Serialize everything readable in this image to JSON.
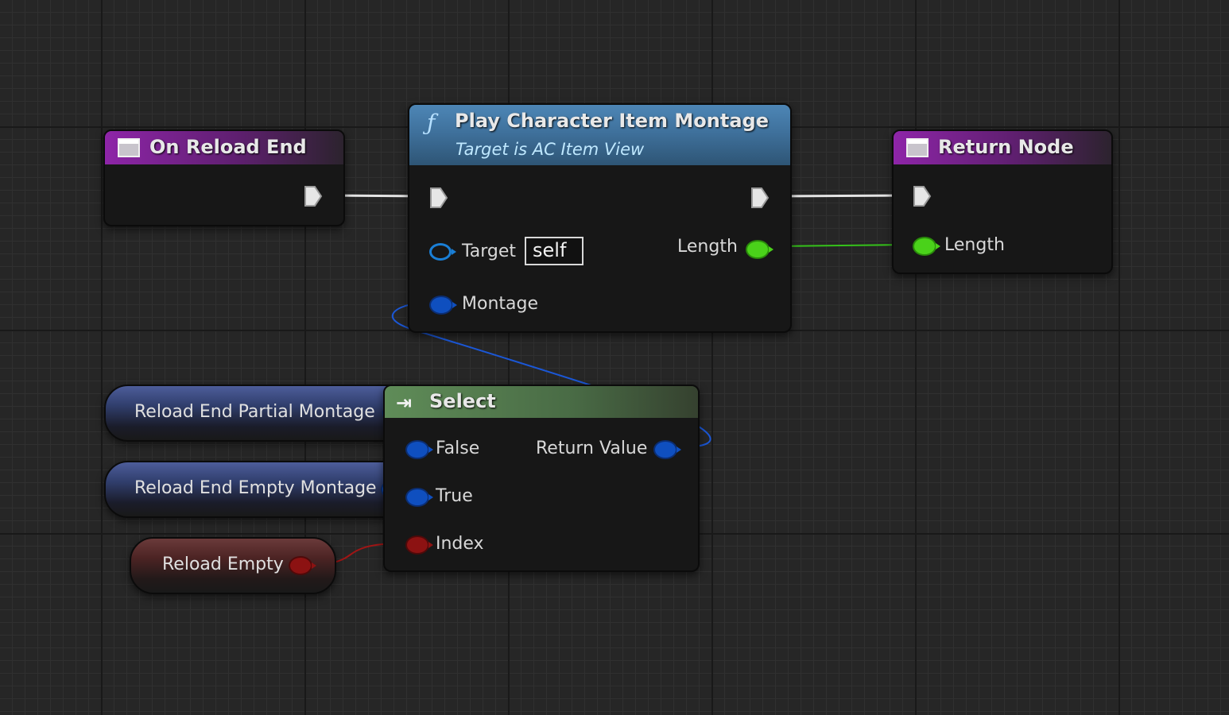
{
  "nodes": {
    "on_reload_end": {
      "title": "On Reload End"
    },
    "play_montage": {
      "title": "Play Character Item Montage",
      "subtitle": "Target is AC Item View",
      "pin_target": "Target",
      "target_value": "self",
      "pin_montage": "Montage",
      "pin_length": "Length"
    },
    "return_node": {
      "title": "Return Node",
      "pin_length": "Length"
    },
    "select": {
      "title": "Select",
      "pin_false": "False",
      "pin_true": "True",
      "pin_index": "Index",
      "pin_return": "Return Value"
    }
  },
  "variables": [
    {
      "label": "Reload End Partial Montage",
      "type": "object"
    },
    {
      "label": "Reload End Empty Montage",
      "type": "object"
    },
    {
      "label": "Reload Empty",
      "type": "boolean"
    }
  ],
  "colors": {
    "background": "#262626",
    "event_header": "#8e25a8",
    "function_header": "#4d86b6",
    "select_header": "#5f8c58",
    "exec_wire": "#e8e8e8",
    "object_pin": "#0f4fbf",
    "boolean_pin": "#8c1212",
    "float_pin": "#4ad21a"
  }
}
